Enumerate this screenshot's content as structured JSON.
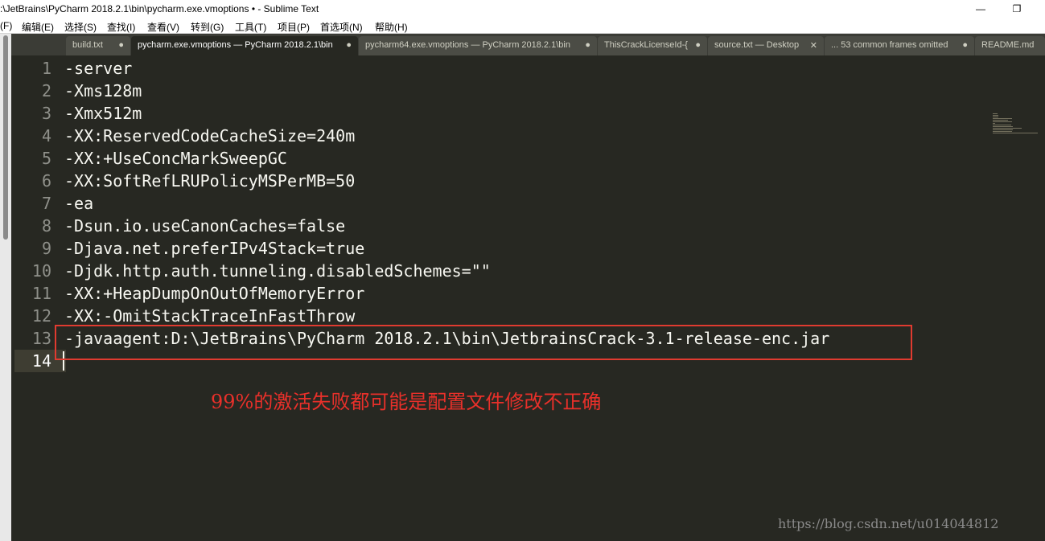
{
  "window": {
    "title": ":\\JetBrains\\PyCharm 2018.2.1\\bin\\pycharm.exe.vmoptions • - Sublime Text",
    "minimize_glyph": "—",
    "restore_glyph": "❐"
  },
  "menu": [
    "(F)",
    "编辑(E)",
    "选择(S)",
    "查找(I)",
    "查看(V)",
    "转到(G)",
    "工具(T)",
    "项目(P)",
    "首选项(N)",
    "帮助(H)"
  ],
  "tabs": [
    {
      "label": "build.txt",
      "close": "●",
      "active": false
    },
    {
      "label": "pycharm.exe.vmoptions — PyCharm 2018.2.1\\bin",
      "close": "●",
      "active": true
    },
    {
      "label": "pycharm64.exe.vmoptions — PyCharm 2018.2.1\\bin",
      "close": "●",
      "active": false
    },
    {
      "label": "ThisCrackLicenseId-{",
      "close": "●",
      "active": false
    },
    {
      "label": "source.txt — Desktop",
      "close": "✕",
      "active": false
    },
    {
      "label": "... 53 common frames omitted",
      "close": "●",
      "active": false
    },
    {
      "label": "README.md",
      "close": "",
      "active": false
    }
  ],
  "editor": {
    "lines": [
      {
        "num": "1",
        "text": "-server"
      },
      {
        "num": "2",
        "text": "-Xms128m"
      },
      {
        "num": "3",
        "text": "-Xmx512m"
      },
      {
        "num": "4",
        "text": "-XX:ReservedCodeCacheSize=240m"
      },
      {
        "num": "5",
        "text": "-XX:+UseConcMarkSweepGC"
      },
      {
        "num": "6",
        "text": "-XX:SoftRefLRUPolicyMSPerMB=50"
      },
      {
        "num": "7",
        "text": "-ea"
      },
      {
        "num": "8",
        "text": "-Dsun.io.useCanonCaches=false"
      },
      {
        "num": "9",
        "text": "-Djava.net.preferIPv4Stack=true"
      },
      {
        "num": "10",
        "text": "-Djdk.http.auth.tunneling.disabledSchemes=\"\""
      },
      {
        "num": "11",
        "text": "-XX:+HeapDumpOnOutOfMemoryError"
      },
      {
        "num": "12",
        "text": "-XX:-OmitStackTraceInFastThrow"
      },
      {
        "num": "13",
        "text": "-javaagent:D:\\JetBrains\\PyCharm 2018.2.1\\bin\\JetbrainsCrack-3.1-release-enc.jar"
      },
      {
        "num": "14",
        "text": ""
      }
    ],
    "current_line": "14"
  },
  "annotation": "99%的激活失败都可能是配置文件修改不正确",
  "watermark": "https://blog.csdn.net/u014044812",
  "colors": {
    "background": "#272822",
    "foreground": "#f8f8f2",
    "gutter": "#8f908a",
    "highlight_box": "#e03b30",
    "annotation": "#e8302a"
  }
}
